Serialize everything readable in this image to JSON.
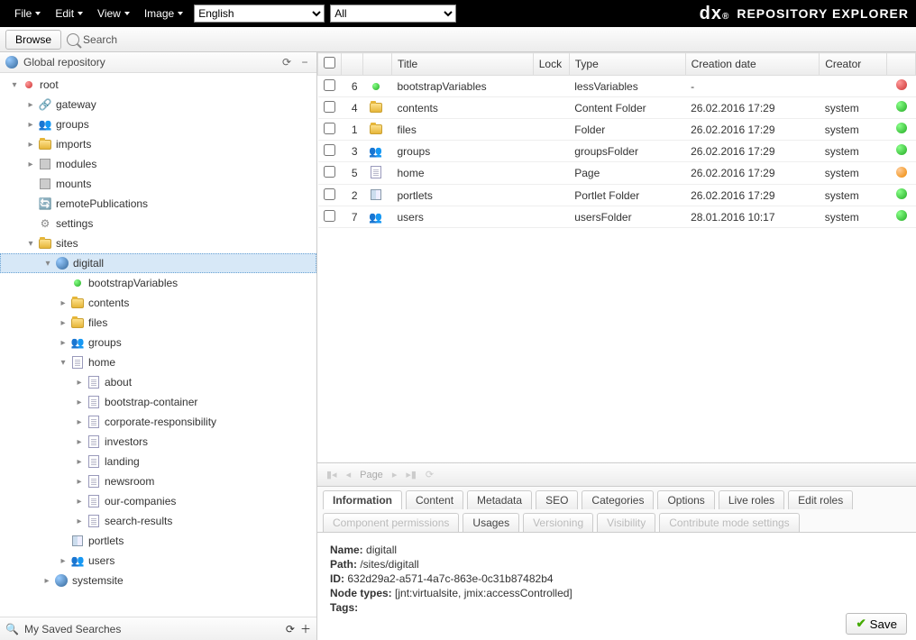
{
  "topbar": {
    "menus": [
      "File",
      "Edit",
      "View",
      "Image"
    ],
    "language": "English",
    "filter": "All",
    "brand_text": "REPOSITORY EXPLORER"
  },
  "toolbar": {
    "browse_label": "Browse",
    "search_label": "Search"
  },
  "sidebar": {
    "header": "Global repository",
    "footer": "My Saved Searches",
    "tree": [
      {
        "depth": 0,
        "expander": "▾",
        "icon": "dot-red",
        "label": "root"
      },
      {
        "depth": 1,
        "expander": "▸",
        "icon": "gateway",
        "label": "gateway"
      },
      {
        "depth": 1,
        "expander": "▸",
        "icon": "people",
        "label": "groups"
      },
      {
        "depth": 1,
        "expander": "▸",
        "icon": "folder",
        "label": "imports"
      },
      {
        "depth": 1,
        "expander": "▸",
        "icon": "server",
        "label": "modules"
      },
      {
        "depth": 1,
        "expander": "",
        "icon": "server",
        "label": "mounts"
      },
      {
        "depth": 1,
        "expander": "",
        "icon": "remote",
        "label": "remotePublications"
      },
      {
        "depth": 1,
        "expander": "",
        "icon": "gear",
        "label": "settings"
      },
      {
        "depth": 1,
        "expander": "▾",
        "icon": "folder",
        "label": "sites"
      },
      {
        "depth": 2,
        "expander": "▾",
        "icon": "globe",
        "label": "digitall",
        "selected": true
      },
      {
        "depth": 3,
        "expander": "",
        "icon": "dot-green",
        "label": "bootstrapVariables"
      },
      {
        "depth": 3,
        "expander": "▸",
        "icon": "folder",
        "label": "contents"
      },
      {
        "depth": 3,
        "expander": "▸",
        "icon": "folder",
        "label": "files"
      },
      {
        "depth": 3,
        "expander": "▸",
        "icon": "people",
        "label": "groups"
      },
      {
        "depth": 3,
        "expander": "▾",
        "icon": "page",
        "label": "home"
      },
      {
        "depth": 4,
        "expander": "▸",
        "icon": "page",
        "label": "about"
      },
      {
        "depth": 4,
        "expander": "▸",
        "icon": "page",
        "label": "bootstrap-container"
      },
      {
        "depth": 4,
        "expander": "▸",
        "icon": "page",
        "label": "corporate-responsibility"
      },
      {
        "depth": 4,
        "expander": "▸",
        "icon": "page",
        "label": "investors"
      },
      {
        "depth": 4,
        "expander": "▸",
        "icon": "page",
        "label": "landing"
      },
      {
        "depth": 4,
        "expander": "▸",
        "icon": "page",
        "label": "newsroom"
      },
      {
        "depth": 4,
        "expander": "▸",
        "icon": "page",
        "label": "our-companies"
      },
      {
        "depth": 4,
        "expander": "▸",
        "icon": "page",
        "label": "search-results"
      },
      {
        "depth": 3,
        "expander": "",
        "icon": "layout",
        "label": "portlets"
      },
      {
        "depth": 3,
        "expander": "▸",
        "icon": "people",
        "label": "users"
      },
      {
        "depth": 2,
        "expander": "▸",
        "icon": "globe",
        "label": "systemsite"
      }
    ]
  },
  "table": {
    "headers": {
      "title": "Title",
      "lock": "Lock",
      "type": "Type",
      "creation": "Creation date",
      "creator": "Creator"
    },
    "rows": [
      {
        "num": "6",
        "icon": "dot-green",
        "title": "bootstrapVariables",
        "type": "lessVariables",
        "creation": "-",
        "creator": "",
        "status": "red"
      },
      {
        "num": "4",
        "icon": "folder",
        "title": "contents",
        "type": "Content Folder",
        "creation": "26.02.2016 17:29",
        "creator": "system",
        "status": "green"
      },
      {
        "num": "1",
        "icon": "folder",
        "title": "files",
        "type": "Folder",
        "creation": "26.02.2016 17:29",
        "creator": "system",
        "status": "green"
      },
      {
        "num": "3",
        "icon": "people",
        "title": "groups",
        "type": "groupsFolder",
        "creation": "26.02.2016 17:29",
        "creator": "system",
        "status": "green"
      },
      {
        "num": "5",
        "icon": "page",
        "title": "home",
        "type": "Page",
        "creation": "26.02.2016 17:29",
        "creator": "system",
        "status": "orange"
      },
      {
        "num": "2",
        "icon": "layout",
        "title": "portlets",
        "type": "Portlet Folder",
        "creation": "26.02.2016 17:29",
        "creator": "system",
        "status": "green"
      },
      {
        "num": "7",
        "icon": "people",
        "title": "users",
        "type": "usersFolder",
        "creation": "28.01.2016 10:17",
        "creator": "system",
        "status": "green"
      }
    ]
  },
  "pager": {
    "page_label": "Page"
  },
  "tabs": [
    {
      "label": "Information",
      "state": "active"
    },
    {
      "label": "Content",
      "state": ""
    },
    {
      "label": "Metadata",
      "state": ""
    },
    {
      "label": "SEO",
      "state": ""
    },
    {
      "label": "Categories",
      "state": ""
    },
    {
      "label": "Options",
      "state": ""
    },
    {
      "label": "Live roles",
      "state": ""
    },
    {
      "label": "Edit roles",
      "state": ""
    },
    {
      "label": "Component permissions",
      "state": "disabled"
    },
    {
      "label": "Usages",
      "state": ""
    },
    {
      "label": "Versioning",
      "state": "disabled"
    },
    {
      "label": "Visibility",
      "state": "disabled"
    },
    {
      "label": "Contribute mode settings",
      "state": "disabled"
    }
  ],
  "info": {
    "name_lbl": "Name:",
    "name_val": "digitall",
    "path_lbl": "Path:",
    "path_val": "/sites/digitall",
    "id_lbl": "ID:",
    "id_val": "632d29a2-a571-4a7c-863e-0c31b87482b4",
    "nodetypes_lbl": "Node types:",
    "nodetypes_val": "[jnt:virtualsite, jmix:accessControlled]",
    "tags_lbl": "Tags:",
    "tags_val": ""
  },
  "save_label": "Save"
}
